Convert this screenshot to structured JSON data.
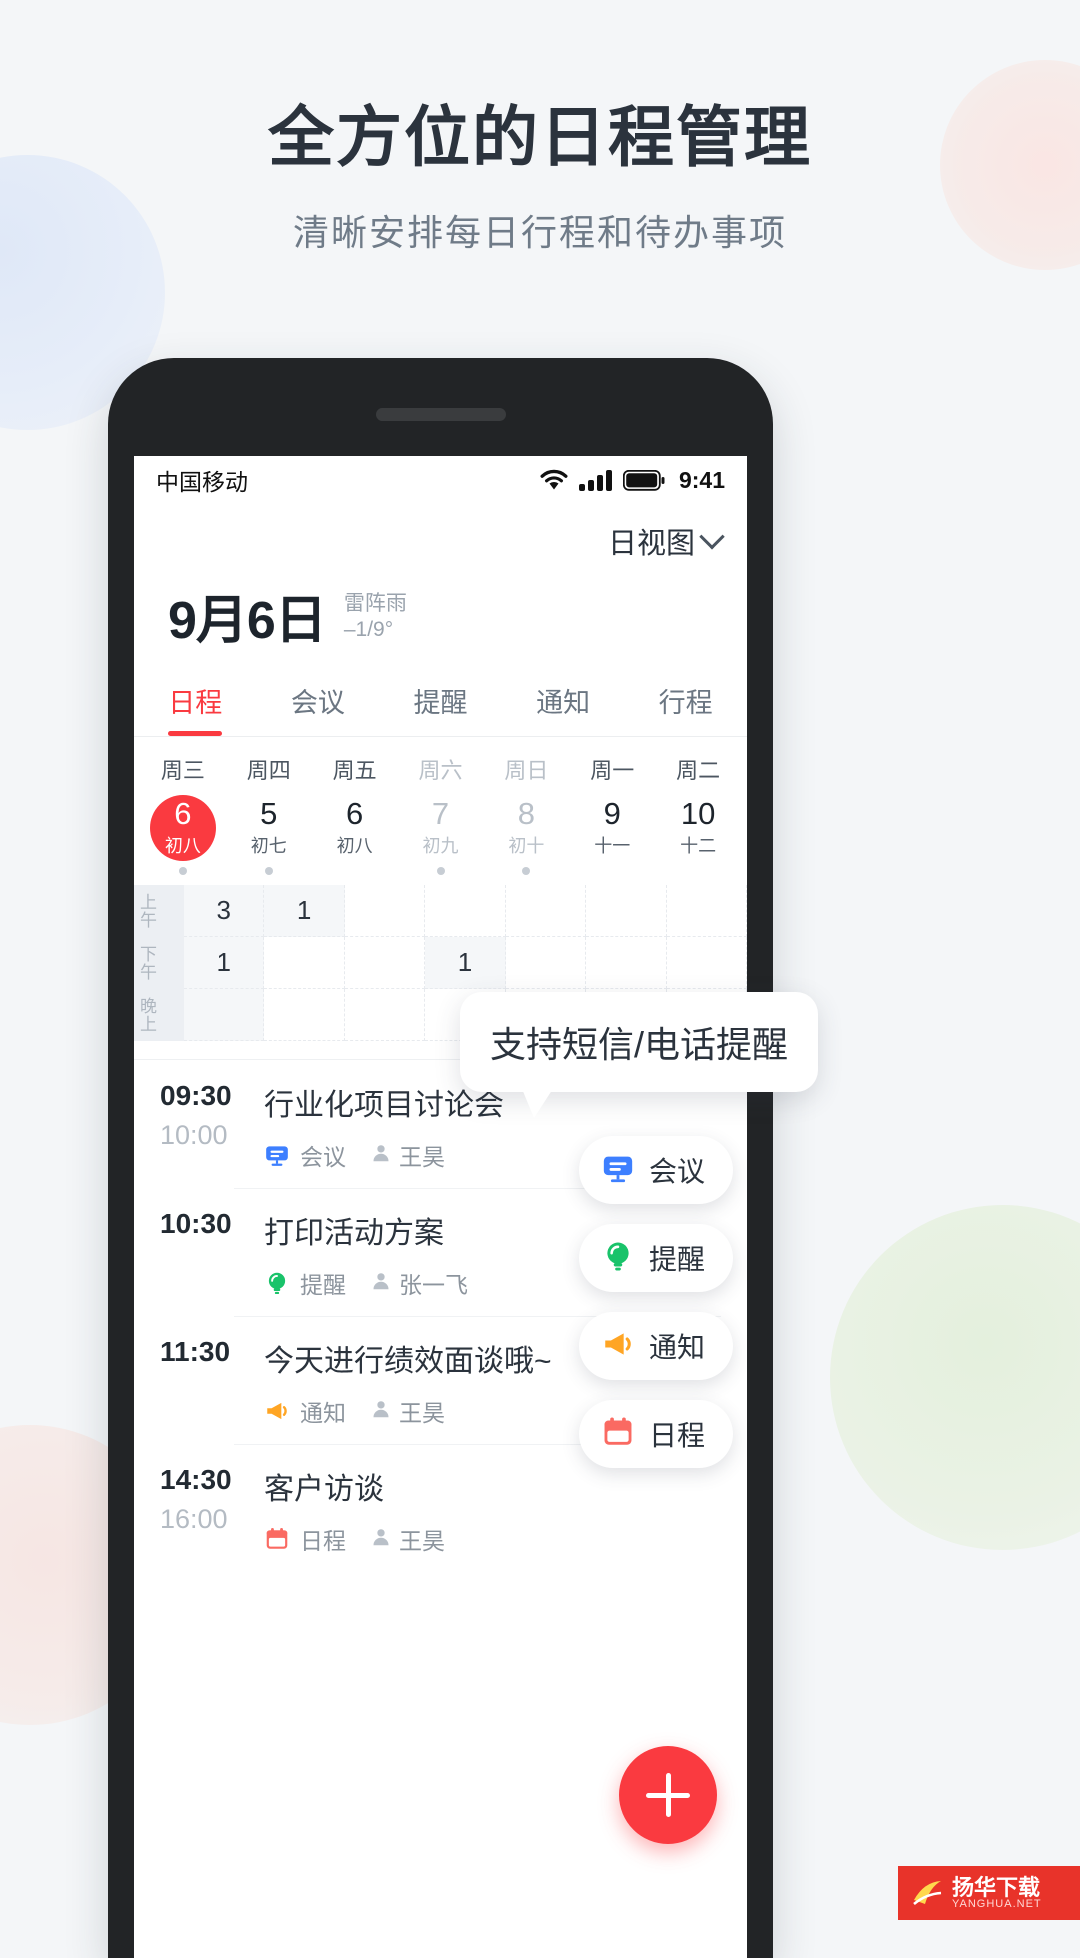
{
  "hero": {
    "title": "全方位的日程管理",
    "subtitle": "清晰安排每日行程和待办事项"
  },
  "status_bar": {
    "carrier": "中国移动",
    "clock": "9:41",
    "icons": [
      "wifi-icon",
      "signal-icon",
      "battery-icon"
    ]
  },
  "view_switch": {
    "label": "日视图",
    "icon": "chevron-down-icon"
  },
  "date_header": {
    "date": "9月6日",
    "weather_desc": "雷阵雨",
    "weather_temp": "–1/9°"
  },
  "tabs": [
    {
      "label": "日程",
      "active": true
    },
    {
      "label": "会议",
      "active": false
    },
    {
      "label": "提醒",
      "active": false
    },
    {
      "label": "通知",
      "active": false
    },
    {
      "label": "行程",
      "active": false
    }
  ],
  "week_strip": [
    {
      "week": "周三",
      "num": "6",
      "lunar": "初八",
      "selected": true,
      "dim": false,
      "dot": true
    },
    {
      "week": "周四",
      "num": "5",
      "lunar": "初七",
      "selected": false,
      "dim": false,
      "dot": true
    },
    {
      "week": "周五",
      "num": "6",
      "lunar": "初八",
      "selected": false,
      "dim": false,
      "dot": false
    },
    {
      "week": "周六",
      "num": "7",
      "lunar": "初九",
      "selected": false,
      "dim": true,
      "dot": true
    },
    {
      "week": "周日",
      "num": "8",
      "lunar": "初十",
      "selected": false,
      "dim": true,
      "dot": true
    },
    {
      "week": "周一",
      "num": "9",
      "lunar": "十一",
      "selected": false,
      "dim": false,
      "dot": false
    },
    {
      "week": "周二",
      "num": "10",
      "lunar": "十二",
      "selected": false,
      "dim": false,
      "dot": false
    }
  ],
  "mini_grid": {
    "periods": [
      "上午",
      "下午",
      "晚上"
    ],
    "rows": [
      [
        "3",
        "1",
        "",
        "",
        "",
        "",
        ""
      ],
      [
        "1",
        "",
        "",
        "1",
        "",
        "",
        ""
      ],
      [
        "",
        "",
        "",
        "",
        "",
        "",
        ""
      ]
    ],
    "shaded": [
      [
        true,
        true,
        false,
        false,
        false,
        false,
        false
      ],
      [
        true,
        false,
        false,
        true,
        false,
        false,
        false
      ],
      [
        true,
        false,
        false,
        false,
        false,
        false,
        false
      ]
    ]
  },
  "events": [
    {
      "start": "09:30",
      "end": "10:00",
      "title": "行业化项目讨论会",
      "tag": "会议",
      "tag_icon": "meeting-icon",
      "tag_color": "#3d7fff",
      "person": "王昊",
      "person_icon": "person-icon"
    },
    {
      "start": "10:30",
      "end": "",
      "title": "打印活动方案",
      "tag": "提醒",
      "tag_icon": "bulb-icon",
      "tag_color": "#19c36a",
      "person": "张一飞",
      "person_icon": "person-icon"
    },
    {
      "start": "11:30",
      "end": "",
      "title": "今天进行绩效面谈哦~",
      "tag": "通知",
      "tag_icon": "megaphone-icon",
      "tag_color": "#ffa524",
      "person": "王昊",
      "person_icon": "person-icon"
    },
    {
      "start": "14:30",
      "end": "16:00",
      "title": "客户访谈",
      "tag": "日程",
      "tag_icon": "calendar-icon",
      "tag_color": "#fa6a62",
      "person": "王昊",
      "person_icon": "person-icon"
    }
  ],
  "tooltip": {
    "text": "支持短信/电话提醒"
  },
  "chips": [
    {
      "label": "会议",
      "icon": "meeting-icon",
      "color": "#3d7fff"
    },
    {
      "label": "提醒",
      "icon": "bulb-icon",
      "color": "#19c36a"
    },
    {
      "label": "通知",
      "icon": "megaphone-icon",
      "color": "#ffa524"
    },
    {
      "label": "日程",
      "icon": "calendar-icon",
      "color": "#fa6a62"
    }
  ],
  "fab": {
    "icon": "plus-icon",
    "color": "#fa3a40"
  },
  "watermark": {
    "title": "扬华下载",
    "subtitle": "YANGHUA.NET"
  },
  "colors": {
    "accent_red": "#fa3a40",
    "page_bg": "#f4f6f8",
    "text_dark": "#2b333d",
    "text_muted": "#9aa3ad"
  }
}
